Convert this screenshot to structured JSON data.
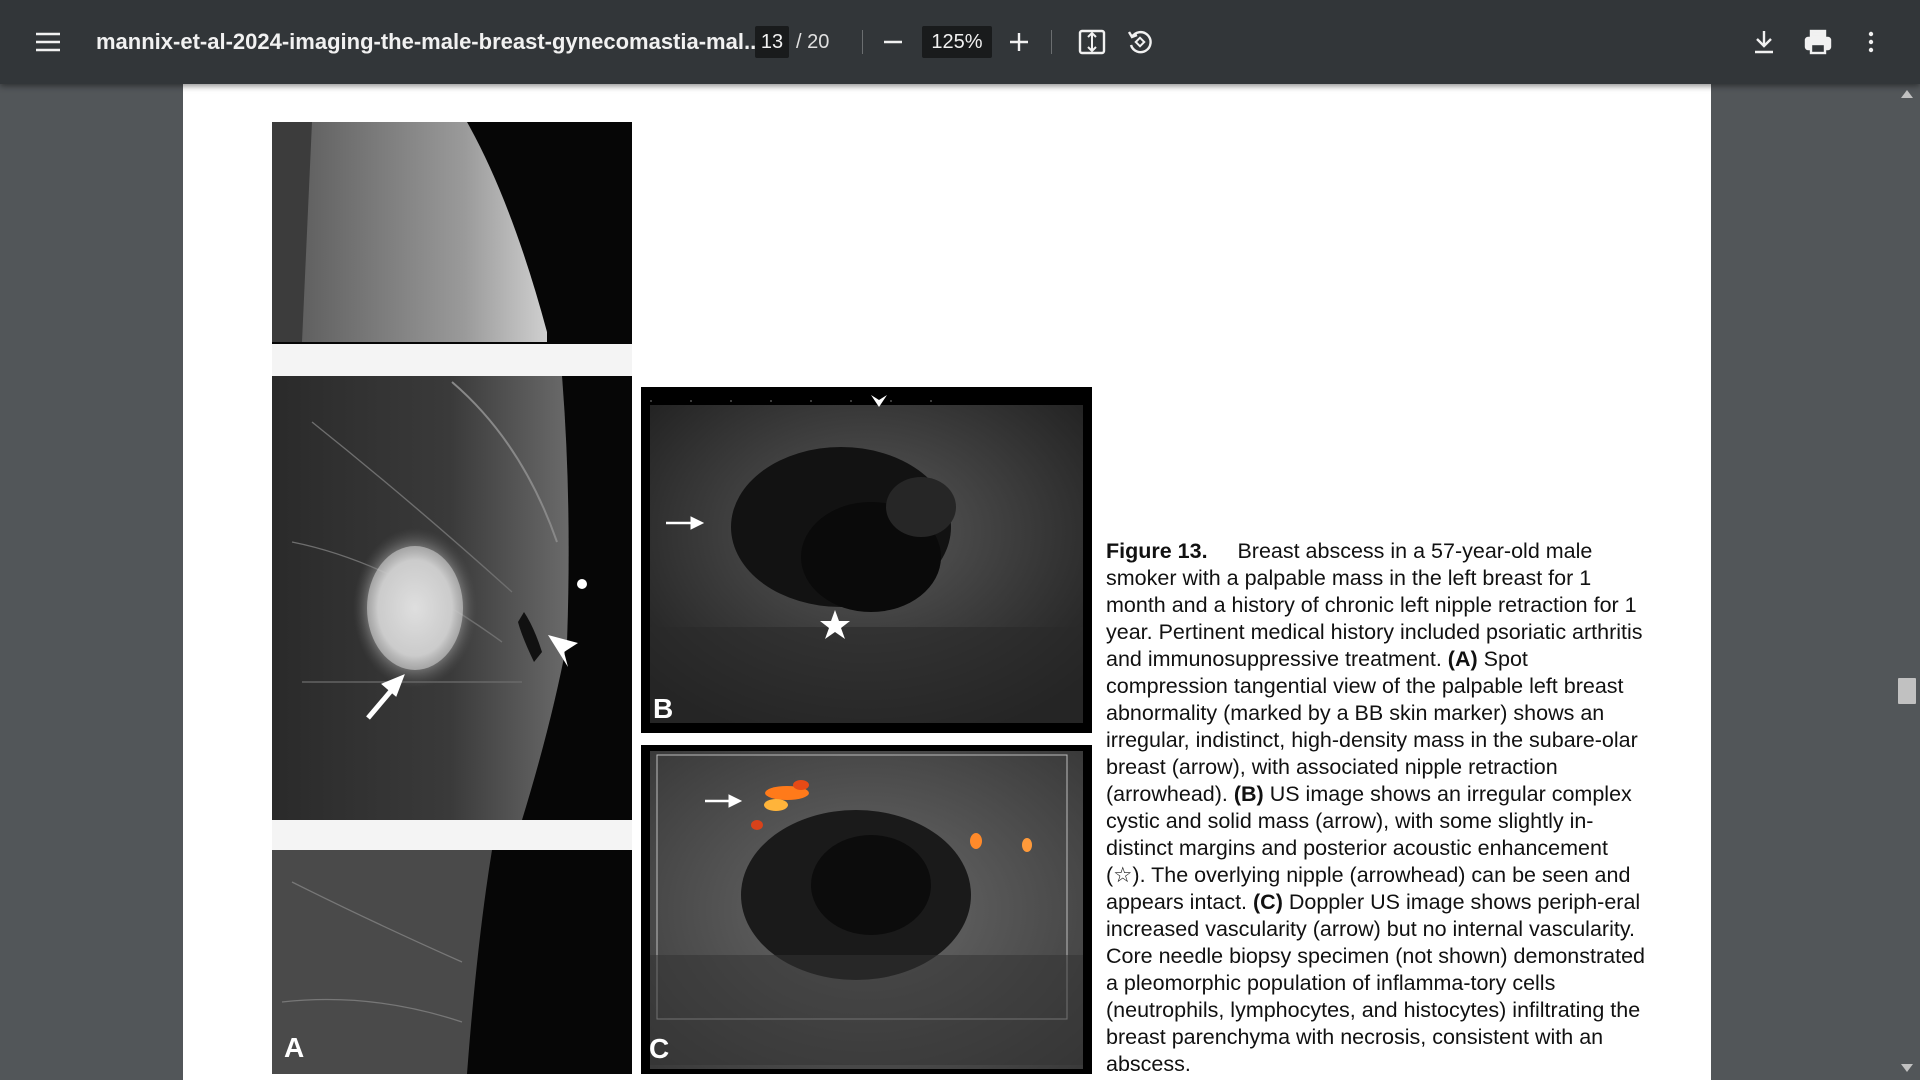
{
  "toolbar": {
    "menu_icon": "hamburger-menu-icon",
    "title": "mannix-et-al-2024-imaging-the-male-breast-gynecomastia-mal...",
    "current_page": "13",
    "total_pages": "/ 20",
    "zoom": "125%",
    "zoom_out_icon": "minus-icon",
    "zoom_in_icon": "plus-icon",
    "fit_icon": "fit-to-page-icon",
    "rotate_icon": "rotate-counterclockwise-icon",
    "download_icon": "download-icon",
    "print_icon": "print-icon",
    "more_icon": "more-vertical-icon"
  },
  "figure": {
    "panel_a_label": "A",
    "panel_b_label": "B",
    "panel_c_label": "C",
    "caption_label": "Figure 13.",
    "caption_intro": "Breast abscess in a 57-year-old male smoker with a palpable mass in the left breast for 1 month and a history of chronic left nipple retraction for 1 year. Pertinent medical history included psoriatic arthritis and immunosuppressive treatment.",
    "a_tag": "(A)",
    "a_text": "Spot compression tangential view of the palpable left breast abnormality (marked by a BB skin marker) shows an irregular, indistinct, high-density mass in the subare-olar breast (arrow), with associated nipple retraction (arrowhead).",
    "b_tag": "(B)",
    "b_text": "US image shows an irregular complex cystic and solid mass (arrow), with some slightly in-distinct margins and posterior acoustic enhancement (☆). The overlying nipple (arrowhead) can be seen and appears intact.",
    "c_tag": "(C)",
    "c_text": "Doppler US image shows periph-eral increased vascularity (arrow) but no internal vascularity. Core needle biopsy specimen (not shown) demonstrated a pleomorphic population of inflamma-tory cells (neutrophils, lymphocytes, and histocytes) infiltrating the breast parenchyma with necrosis, consistent with an abscess."
  }
}
